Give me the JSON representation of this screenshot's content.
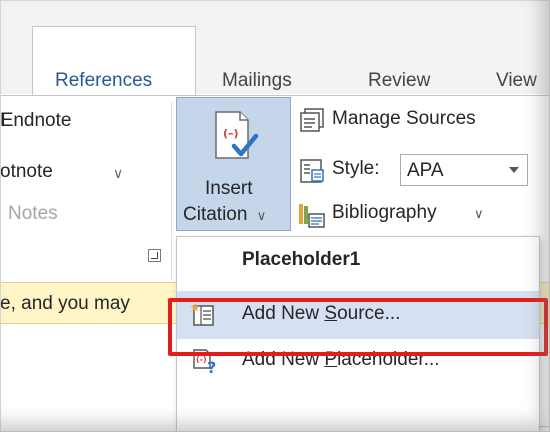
{
  "tabs": {
    "references": "References",
    "mailings": "Mailings",
    "review": "Review",
    "view": "View"
  },
  "ribbon": {
    "footnotes_group": {
      "endnote_label": "Endnote",
      "footnote_label": "otnote",
      "group_label": "Notes"
    },
    "citations_group": {
      "insert_citation_line1": "Insert",
      "insert_citation_line2": "Citation",
      "manage_sources_label": "Manage Sources",
      "style_label": "Style:",
      "style_value": "APA",
      "bibliography_label": "Bibliography"
    }
  },
  "message_bar": {
    "text": "e, and you may"
  },
  "citation_menu": {
    "placeholder_item": "Placeholder1",
    "add_new_source": {
      "before": "Add New ",
      "accel": "S",
      "after": "ource..."
    },
    "add_new_placeholder": {
      "before": "Add New ",
      "accel": "P",
      "after": "laceholder..."
    }
  },
  "colors": {
    "ribbon_accent": "#2b579a",
    "selected_button": "#c5d5ea",
    "hover_item": "#d5e1f2",
    "message_bar": "#fff5c7",
    "callout_red": "#e31c1c"
  },
  "icons": {
    "insert_citation": "insert-citation-icon",
    "manage_sources": "manage-sources-icon",
    "style": "style-icon",
    "bibliography": "bibliography-icon",
    "add_new_source": "add-new-source-icon",
    "add_new_placeholder": "add-new-placeholder-icon"
  }
}
